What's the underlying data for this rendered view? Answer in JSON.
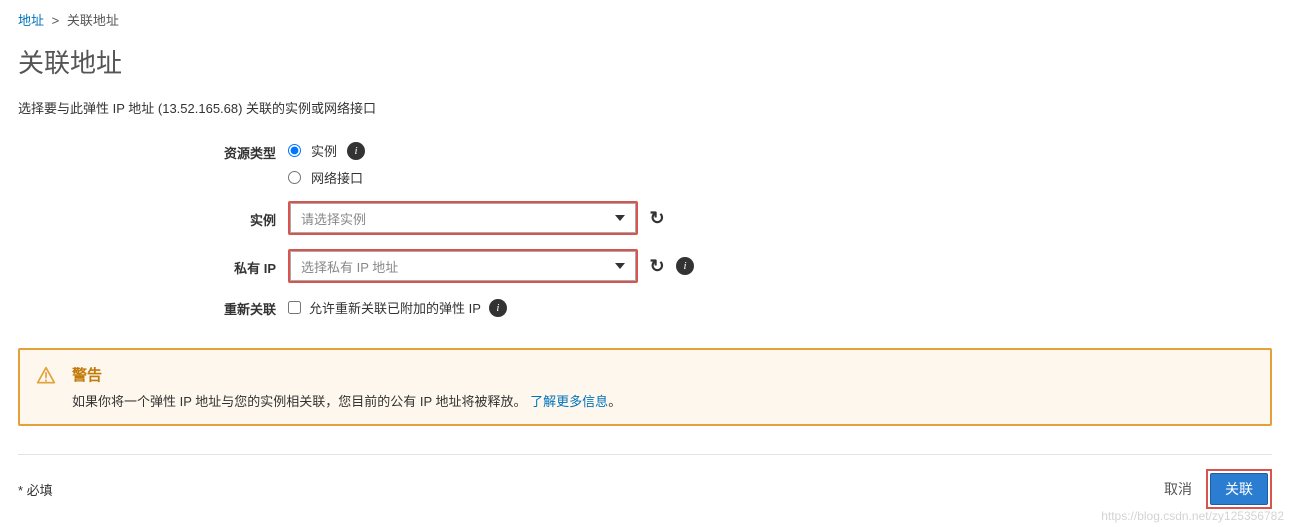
{
  "breadcrumb": {
    "parent": "地址",
    "separator": ">",
    "current": "关联地址"
  },
  "page_title": "关联地址",
  "intro": "选择要与此弹性 IP 地址 (13.52.165.68) 关联的实例或网络接口",
  "form": {
    "resource_type": {
      "label": "资源类型",
      "options": {
        "instance": "实例",
        "eni": "网络接口"
      },
      "selected": "instance"
    },
    "instance": {
      "label": "实例",
      "placeholder": "请选择实例"
    },
    "private_ip": {
      "label": "私有 IP",
      "placeholder": "选择私有 IP 地址"
    },
    "reassociate": {
      "label": "重新关联",
      "checkbox_label": "允许重新关联已附加的弹性 IP"
    }
  },
  "alert": {
    "title": "警告",
    "message": "如果你将一个弹性 IP 地址与您的实例相关联，您目前的公有 IP 地址将被释放。",
    "link": "了解更多信息",
    "period": "。"
  },
  "footer": {
    "required": "* 必填",
    "cancel": "取消",
    "submit": "关联"
  },
  "watermark": "https://blog.csdn.net/zy125356782"
}
